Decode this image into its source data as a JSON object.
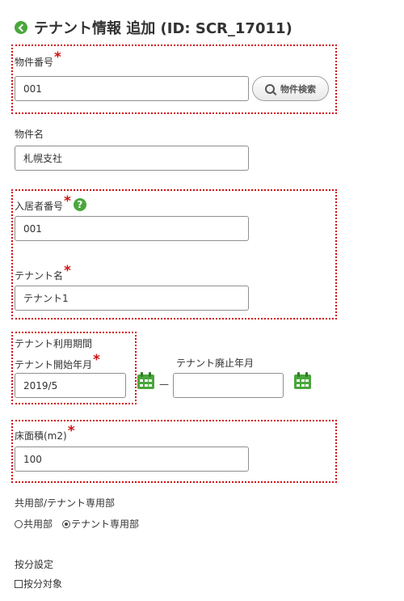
{
  "page": {
    "title": "テナント情報 追加 (ID: SCR_17011)",
    "title_icon": "circle-arrow-left-icon"
  },
  "property": {
    "code_label": "物件番号",
    "code_value": "001",
    "search_button_label": "物件検索",
    "name_label": "物件名",
    "name_value": "札幌支社"
  },
  "resident": {
    "number_label": "入居者番号",
    "number_value": "001",
    "help_glyph": "?",
    "tenant_name_label": "テナント名",
    "tenant_name_value": "テナント1"
  },
  "period": {
    "section_label": "テナント利用期間",
    "start_label": "テナント開始年月",
    "start_value": "2019/5",
    "separator": "—",
    "end_label": "テナント廃止年月",
    "end_value": ""
  },
  "area": {
    "label": "床面積(m2)",
    "value": "100"
  },
  "usage": {
    "label": "共用部/テナント専用部",
    "options": [
      {
        "label": "共用部",
        "selected": false
      },
      {
        "label": "テナント専用部",
        "selected": true
      }
    ]
  },
  "allocation": {
    "label": "按分設定",
    "checkbox_label": "按分対象",
    "checked": false
  },
  "required_mark": "*",
  "colors": {
    "accent_green": "#4aa63c",
    "required_red": "#d01010"
  }
}
